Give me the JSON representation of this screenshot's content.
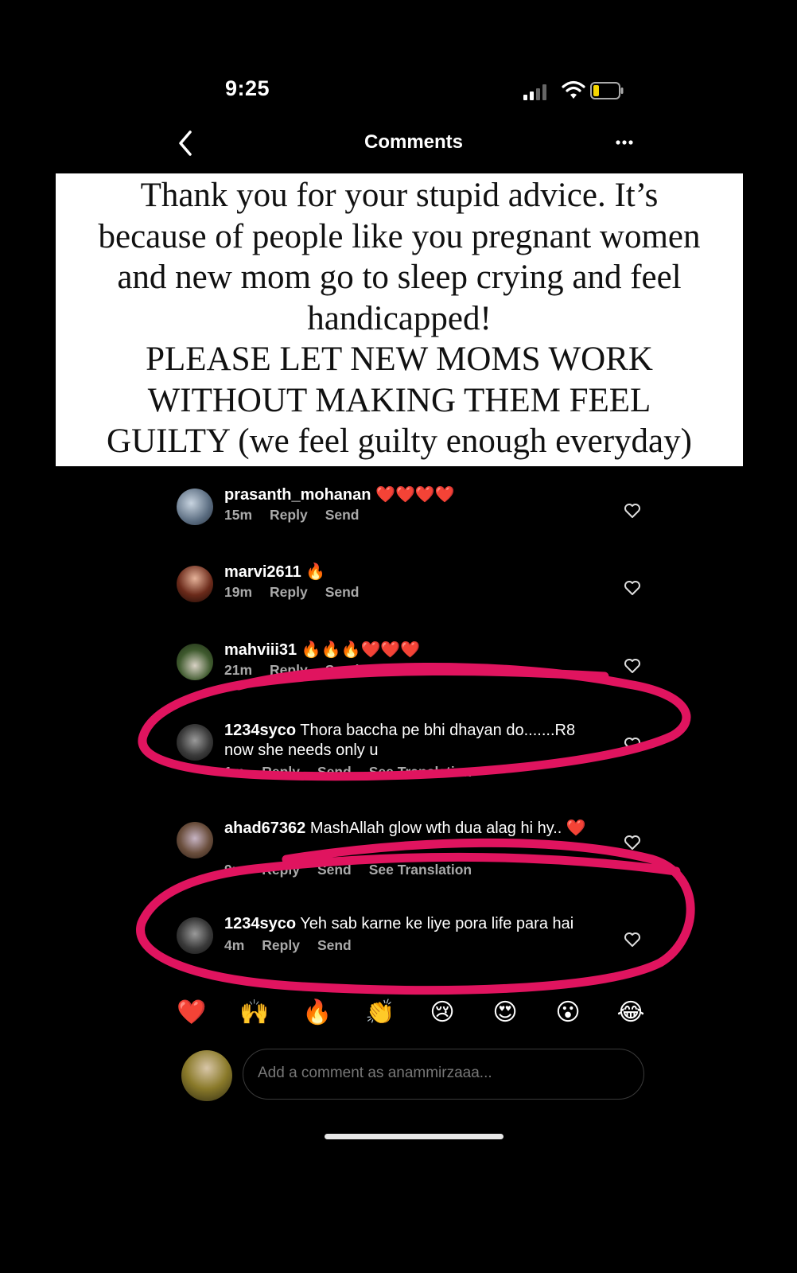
{
  "status_bar": {
    "time": "9:25"
  },
  "header": {
    "title": "Comments"
  },
  "overlay": {
    "lines": [
      "Thank you for your stupid advice. It’s",
      "because of people like you pregnant women",
      "and new mom go to sleep crying and feel",
      "handicapped!",
      "PLEASE LET NEW MOMS WORK",
      "WITHOUT MAKING THEM FEEL",
      "GUILTY (we feel guilty enough everyday)"
    ]
  },
  "comments": [
    {
      "user": "prasanth_mohanan",
      "text": "❤️❤️❤️❤️",
      "time": "15m",
      "reply": "Reply",
      "send": "Send",
      "see_translation": ""
    },
    {
      "user": "marvi2611",
      "text": "🔥",
      "time": "19m",
      "reply": "Reply",
      "send": "Send",
      "see_translation": ""
    },
    {
      "user": "mahviii31",
      "text": "🔥🔥🔥❤️❤️❤️",
      "time": "21m",
      "reply": "Reply",
      "send": "Send",
      "see_translation": ""
    },
    {
      "user": "1234syco",
      "text": "Thora baccha pe bhi dhayan do.......R8 now she needs only u",
      "time": "1m",
      "reply": "Reply",
      "send": "Send",
      "see_translation": "See Translation"
    },
    {
      "user": "ahad67362",
      "text": "MashAllah glow wth dua alag hi hy.. ❤️",
      "time": "9m",
      "reply": "Reply",
      "send": "Send",
      "see_translation": "See Translation"
    },
    {
      "user": "1234syco",
      "text": "Yeh sab karne ke liye pora life para hai",
      "time": "4m",
      "reply": "Reply",
      "send": "Send",
      "see_translation": ""
    }
  ],
  "reactions": [
    "❤️",
    "🙌",
    "🔥",
    "👏",
    "😢",
    "😍",
    "😮",
    "😂"
  ],
  "composer": {
    "placeholder": "Add a comment as anammirzaaa..."
  },
  "icons": {
    "back": "chevron-left-icon",
    "more": "more-horizontal-icon",
    "like": "heart-outline-icon",
    "signal": "cellular-signal-icon",
    "wifi": "wifi-icon",
    "battery": "battery-low-icon"
  },
  "colors": {
    "annotation": "#e0145f",
    "background": "#000000"
  }
}
